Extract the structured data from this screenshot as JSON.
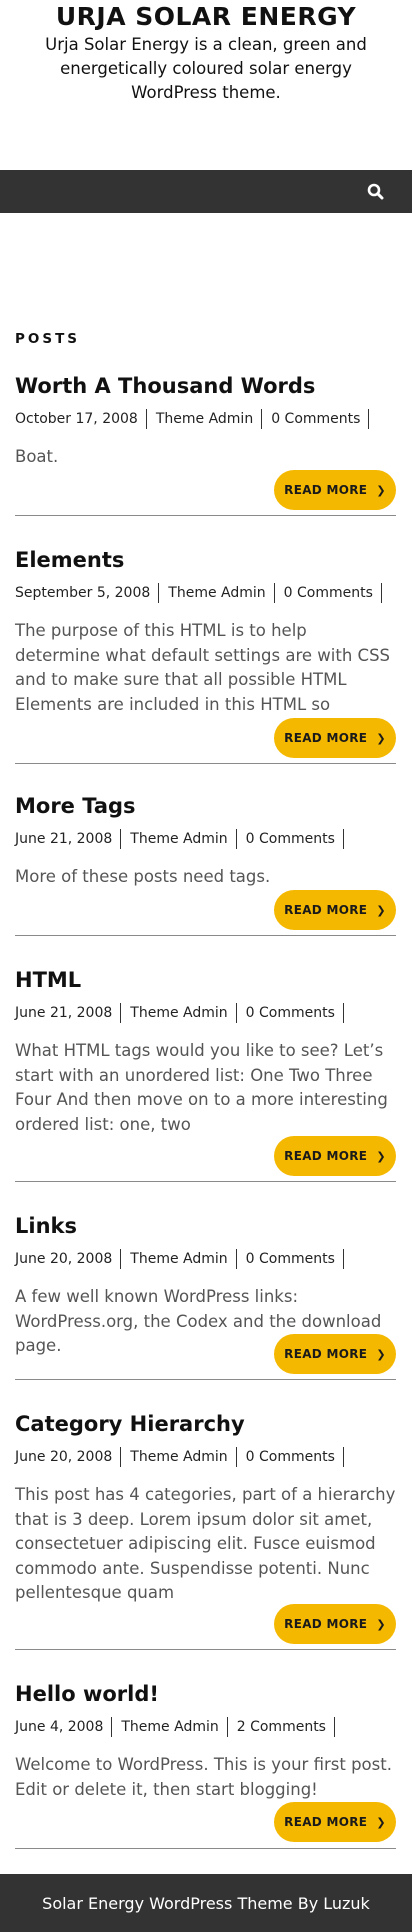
{
  "header": {
    "title": "URJA SOLAR ENERGY",
    "description": "Urja Solar Energy is a clean, green and energetically coloured solar energy WordPress theme."
  },
  "nav": {
    "search_icon": "search-icon"
  },
  "section_label": "POSTS",
  "read_more_label": "READ MORE",
  "posts": [
    {
      "title": "Worth A Thousand Words",
      "date": "October 17, 2008",
      "author": "Theme Admin",
      "comments": "0 Comments",
      "excerpt": "Boat."
    },
    {
      "title": "Elements",
      "date": "September 5, 2008",
      "author": "Theme Admin",
      "comments": "0 Comments",
      "excerpt": "The purpose of this HTML is to help determine what default settings are with CSS and to make sure that all possible HTML Elements are included in this HTML so"
    },
    {
      "title": "More Tags",
      "date": "June 21, 2008",
      "author": "Theme Admin",
      "comments": "0 Comments",
      "excerpt": "More of these posts need tags."
    },
    {
      "title": "HTML",
      "date": "June 21, 2008",
      "author": "Theme Admin",
      "comments": "0 Comments",
      "excerpt": "What HTML tags would you like to see? Let’s start with an unordered list: One Two Three Four And then move on to a more interesting ordered list: one, two"
    },
    {
      "title": "Links",
      "date": "June 20, 2008",
      "author": "Theme Admin",
      "comments": "0 Comments",
      "excerpt": "A few well known WordPress links: WordPress.org, the Codex and the download page."
    },
    {
      "title": "Category Hierarchy",
      "date": "June 20, 2008",
      "author": "Theme Admin",
      "comments": "0 Comments",
      "excerpt": "This post has 4 categories, part of a hierarchy that is 3 deep. Lorem ipsum dolor sit amet, consectetuer adipiscing elit. Fusce euismod commodo ante. Suspendisse potenti. Nunc pellentesque quam"
    },
    {
      "title": "Hello world!",
      "date": "June 4, 2008",
      "author": "Theme Admin",
      "comments": "2 Comments",
      "excerpt": "Welcome to WordPress. This is your first post. Edit or delete it, then start blogging!"
    }
  ],
  "footer": {
    "credit": "Solar Energy WordPress Theme By Luzuk"
  },
  "colors": {
    "accent": "#f5b800",
    "nav_bg": "#333333",
    "footer_bg": "#333333",
    "text": "#222222",
    "excerpt": "#555555"
  }
}
